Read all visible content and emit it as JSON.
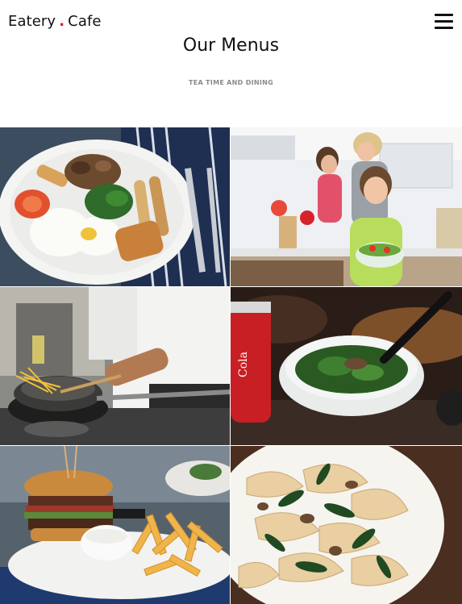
{
  "header": {
    "brand_left": "Eatery",
    "brand_dot": ".",
    "brand_right": "Cafe",
    "menu_icon": "hamburger-icon"
  },
  "section": {
    "title": "Our Menus",
    "subtitle": "TEA TIME AND DINING"
  },
  "colors": {
    "brand_dot": "#e0162b",
    "subtitle": "#8a8a8a"
  },
  "gallery": [
    {
      "subject": "breakfast plate"
    },
    {
      "subject": "family in kitchen"
    },
    {
      "subject": "chef cooking pasta"
    },
    {
      "subject": "salad bowl with soda"
    },
    {
      "subject": "burger and fries"
    },
    {
      "subject": "pasta with greens"
    }
  ]
}
